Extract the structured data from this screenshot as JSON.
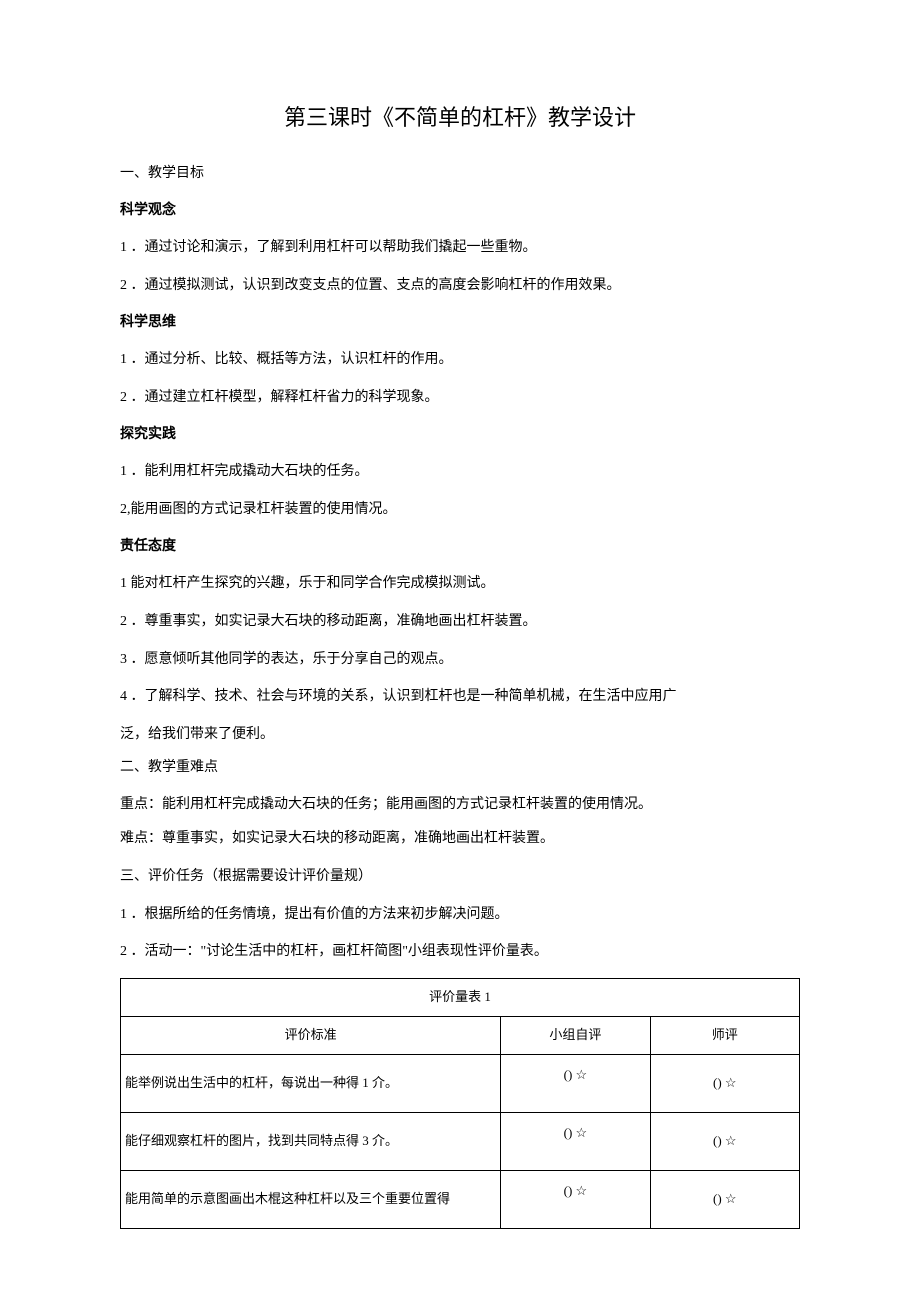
{
  "title": "第三课时《不简单的杠杆》教学设计",
  "sec1_label": "一、教学目标",
  "h_concept": "科学观念",
  "concept_1": "1 ．通过讨论和演示，了解到利用杠杆可以帮助我们撬起一些重物。",
  "concept_2": "2 ．通过模拟测试，认识到改变支点的位置、支点的高度会影响杠杆的作用效果。",
  "h_thinking": "科学思维",
  "thinking_1": "1 ．通过分析、比较、概括等方法，认识杠杆的作用。",
  "thinking_2": "2 ．通过建立杠杆模型，解释杠杆省力的科学现象。",
  "h_practice": "探究实践",
  "practice_1": "1 ．能利用杠杆完成撬动大石块的任务。",
  "practice_2": "2,能用画图的方式记录杠杆装置的使用情况。",
  "h_attitude": "责任态度",
  "attitude_1": "1 能对杠杆产生探究的兴趣，乐于和同学合作完成模拟测试。",
  "attitude_2": "2 ．尊重事实，如实记录大石块的移动距离，准确地画出杠杆装置。",
  "attitude_3": "3 ．愿意倾听其他同学的表达，乐于分享自己的观点。",
  "attitude_4": "4 ．了解科学、技术、社会与环境的关系，认识到杠杆也是一种简单机械，在生活中应用广",
  "attitude_4b": "泛，给我们带来了便利。",
  "sec2_label": "二、教学重难点",
  "keypoint": "重点：能利用杠杆完成撬动大石块的任务；能用画图的方式记录杠杆装置的使用情况。",
  "difficulty": "难点：尊重事实，如实记录大石块的移动距离，准确地画出杠杆装置。",
  "sec3_label": "三、评价任务（根据需要设计评价量规）",
  "eval_1": "1 ．根据所给的任务情境，提出有价值的方法来初步解决问题。",
  "eval_2": "2 ．活动一：\"讨论生活中的杠杆，画杠杆简图\"小组表现性评价量表。",
  "table": {
    "caption": "评价量表 1",
    "col1": "评价标准",
    "col2": "小组自评",
    "col3": "师评",
    "row1_criteria": "能举例说出生活中的杠杆，每说出一种得 1 介。",
    "row2_criteria": "能仔细观察杠杆的图片，找到共同特点得 3 介。",
    "row3_criteria": "能用简单的示意图画出木棍这种杠杆以及三个重要位置得",
    "rating": "() ☆"
  }
}
